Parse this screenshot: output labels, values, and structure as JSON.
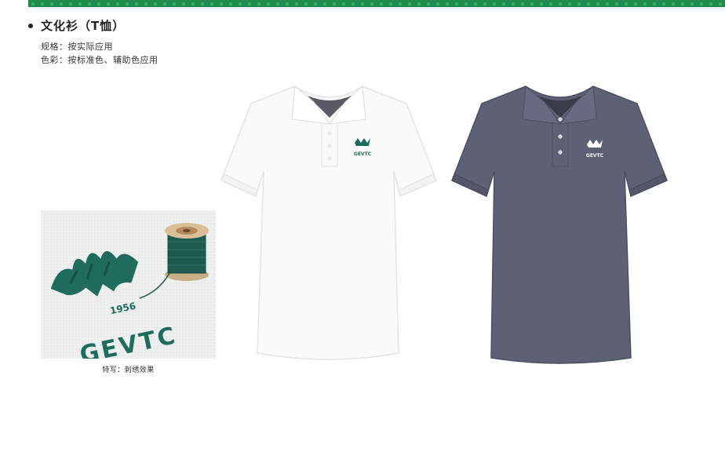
{
  "title": "文化衫（T恤）",
  "spec_lines": [
    "规格：按实际应用",
    "色彩：按标准色、辅助色应用"
  ],
  "closeup": {
    "year": "1956",
    "brand": "GEVTC",
    "caption": "特写：刺绣效果"
  },
  "shirts": [
    {
      "name": "white polo",
      "color": "#ffffff",
      "logo_text": "GEVTC"
    },
    {
      "name": "grey polo",
      "color": "#5e6075",
      "logo_text": "GEVTC"
    }
  ],
  "colors": {
    "brand_green": "#1f6b5c",
    "band_green": "#1f8a4c"
  }
}
